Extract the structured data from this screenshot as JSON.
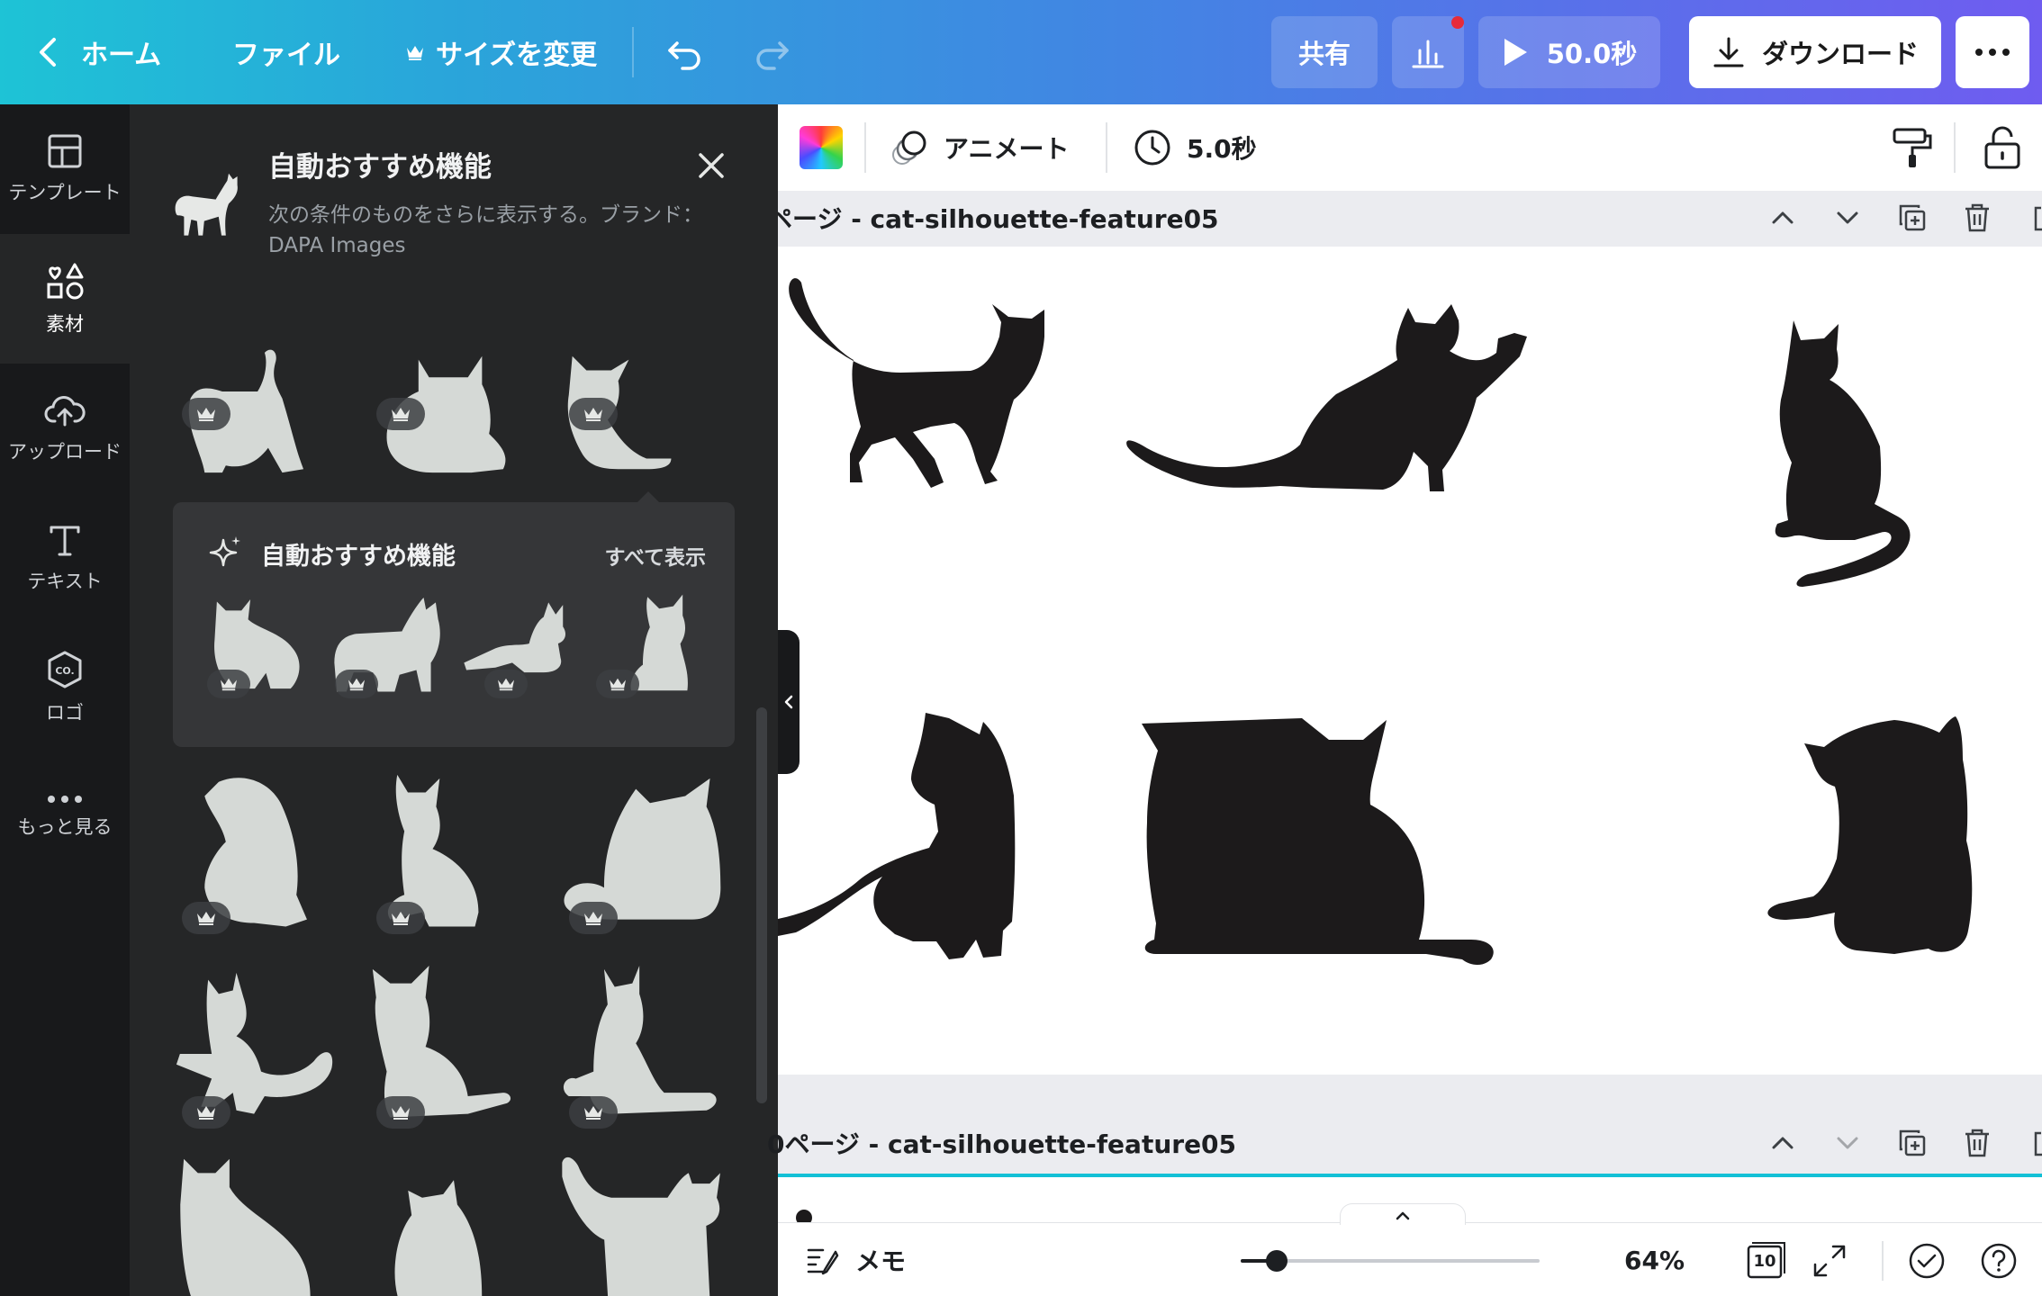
{
  "topbar": {
    "home": "ホーム",
    "file": "ファイル",
    "resize": "サイズを変更",
    "share": "共有",
    "play_duration": "50.0秒",
    "download": "ダウンロード"
  },
  "rail": {
    "items": [
      {
        "label": "テンプレート"
      },
      {
        "label": "素材"
      },
      {
        "label": "アップロード"
      },
      {
        "label": "テキスト"
      },
      {
        "label": "ロゴ"
      },
      {
        "label": "もっと見る"
      }
    ]
  },
  "panel": {
    "title": "自動おすすめ機能",
    "description": "次の条件のものをさらに表示する。ブランド：DAPA Images",
    "suggest": {
      "title": "自動おすすめ機能",
      "see_all": "すべて表示"
    }
  },
  "context_bar": {
    "animate": "アニメート",
    "duration": "5.0秒"
  },
  "pages": [
    {
      "title": "ページ - cat-silhouette-feature05"
    },
    {
      "title": "0ページ - cat-silhouette-feature05"
    }
  ],
  "footer": {
    "notes": "メモ",
    "zoom": "64%",
    "zoom_fraction": 0.12,
    "page_count": "10"
  },
  "colors": {
    "accent_start": "#1ec3d6",
    "accent_end": "#6f5cf0",
    "panel_bg": "#252627",
    "thumb_fill": "#d5d9d6",
    "silhouette": "#1c1a1b",
    "notification": "#e62b3a"
  }
}
